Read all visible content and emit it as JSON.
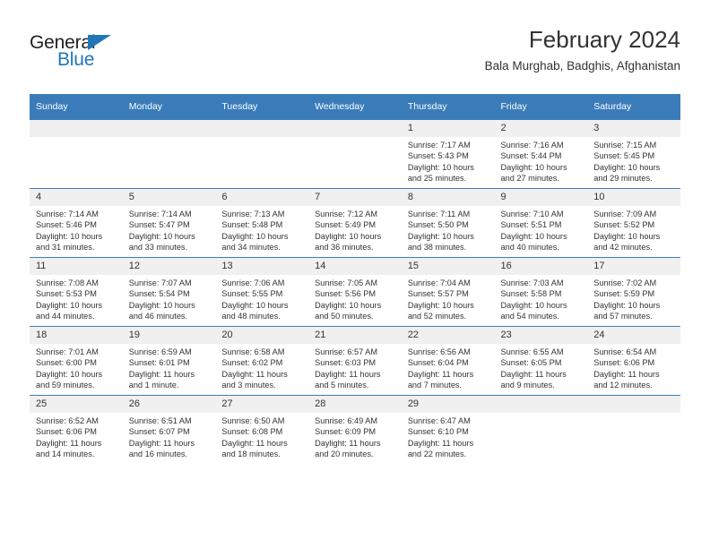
{
  "brand": {
    "name_top": "General",
    "name_bottom": "Blue",
    "accent_color": "#1f77b8"
  },
  "header": {
    "title": "February 2024",
    "subtitle": "Bala Murghab, Badghis, Afghanistan"
  },
  "theme": {
    "header_blue": "#3a7cb9",
    "daynum_gray": "#f0f0f0",
    "text": "#333333"
  },
  "calendar": {
    "weekday_headers": [
      "Sunday",
      "Monday",
      "Tuesday",
      "Wednesday",
      "Thursday",
      "Friday",
      "Saturday"
    ],
    "weeks": [
      [
        {
          "day": "",
          "sunrise": "",
          "sunset": "",
          "daylight_line1": "",
          "daylight_line2": "",
          "empty": true
        },
        {
          "day": "",
          "sunrise": "",
          "sunset": "",
          "daylight_line1": "",
          "daylight_line2": "",
          "empty": true
        },
        {
          "day": "",
          "sunrise": "",
          "sunset": "",
          "daylight_line1": "",
          "daylight_line2": "",
          "empty": true
        },
        {
          "day": "",
          "sunrise": "",
          "sunset": "",
          "daylight_line1": "",
          "daylight_line2": "",
          "empty": true
        },
        {
          "day": "1",
          "sunrise": "Sunrise: 7:17 AM",
          "sunset": "Sunset: 5:43 PM",
          "daylight_line1": "Daylight: 10 hours",
          "daylight_line2": "and 25 minutes.",
          "empty": false
        },
        {
          "day": "2",
          "sunrise": "Sunrise: 7:16 AM",
          "sunset": "Sunset: 5:44 PM",
          "daylight_line1": "Daylight: 10 hours",
          "daylight_line2": "and 27 minutes.",
          "empty": false
        },
        {
          "day": "3",
          "sunrise": "Sunrise: 7:15 AM",
          "sunset": "Sunset: 5:45 PM",
          "daylight_line1": "Daylight: 10 hours",
          "daylight_line2": "and 29 minutes.",
          "empty": false
        }
      ],
      [
        {
          "day": "4",
          "sunrise": "Sunrise: 7:14 AM",
          "sunset": "Sunset: 5:46 PM",
          "daylight_line1": "Daylight: 10 hours",
          "daylight_line2": "and 31 minutes.",
          "empty": false
        },
        {
          "day": "5",
          "sunrise": "Sunrise: 7:14 AM",
          "sunset": "Sunset: 5:47 PM",
          "daylight_line1": "Daylight: 10 hours",
          "daylight_line2": "and 33 minutes.",
          "empty": false
        },
        {
          "day": "6",
          "sunrise": "Sunrise: 7:13 AM",
          "sunset": "Sunset: 5:48 PM",
          "daylight_line1": "Daylight: 10 hours",
          "daylight_line2": "and 34 minutes.",
          "empty": false
        },
        {
          "day": "7",
          "sunrise": "Sunrise: 7:12 AM",
          "sunset": "Sunset: 5:49 PM",
          "daylight_line1": "Daylight: 10 hours",
          "daylight_line2": "and 36 minutes.",
          "empty": false
        },
        {
          "day": "8",
          "sunrise": "Sunrise: 7:11 AM",
          "sunset": "Sunset: 5:50 PM",
          "daylight_line1": "Daylight: 10 hours",
          "daylight_line2": "and 38 minutes.",
          "empty": false
        },
        {
          "day": "9",
          "sunrise": "Sunrise: 7:10 AM",
          "sunset": "Sunset: 5:51 PM",
          "daylight_line1": "Daylight: 10 hours",
          "daylight_line2": "and 40 minutes.",
          "empty": false
        },
        {
          "day": "10",
          "sunrise": "Sunrise: 7:09 AM",
          "sunset": "Sunset: 5:52 PM",
          "daylight_line1": "Daylight: 10 hours",
          "daylight_line2": "and 42 minutes.",
          "empty": false
        }
      ],
      [
        {
          "day": "11",
          "sunrise": "Sunrise: 7:08 AM",
          "sunset": "Sunset: 5:53 PM",
          "daylight_line1": "Daylight: 10 hours",
          "daylight_line2": "and 44 minutes.",
          "empty": false
        },
        {
          "day": "12",
          "sunrise": "Sunrise: 7:07 AM",
          "sunset": "Sunset: 5:54 PM",
          "daylight_line1": "Daylight: 10 hours",
          "daylight_line2": "and 46 minutes.",
          "empty": false
        },
        {
          "day": "13",
          "sunrise": "Sunrise: 7:06 AM",
          "sunset": "Sunset: 5:55 PM",
          "daylight_line1": "Daylight: 10 hours",
          "daylight_line2": "and 48 minutes.",
          "empty": false
        },
        {
          "day": "14",
          "sunrise": "Sunrise: 7:05 AM",
          "sunset": "Sunset: 5:56 PM",
          "daylight_line1": "Daylight: 10 hours",
          "daylight_line2": "and 50 minutes.",
          "empty": false
        },
        {
          "day": "15",
          "sunrise": "Sunrise: 7:04 AM",
          "sunset": "Sunset: 5:57 PM",
          "daylight_line1": "Daylight: 10 hours",
          "daylight_line2": "and 52 minutes.",
          "empty": false
        },
        {
          "day": "16",
          "sunrise": "Sunrise: 7:03 AM",
          "sunset": "Sunset: 5:58 PM",
          "daylight_line1": "Daylight: 10 hours",
          "daylight_line2": "and 54 minutes.",
          "empty": false
        },
        {
          "day": "17",
          "sunrise": "Sunrise: 7:02 AM",
          "sunset": "Sunset: 5:59 PM",
          "daylight_line1": "Daylight: 10 hours",
          "daylight_line2": "and 57 minutes.",
          "empty": false
        }
      ],
      [
        {
          "day": "18",
          "sunrise": "Sunrise: 7:01 AM",
          "sunset": "Sunset: 6:00 PM",
          "daylight_line1": "Daylight: 10 hours",
          "daylight_line2": "and 59 minutes.",
          "empty": false
        },
        {
          "day": "19",
          "sunrise": "Sunrise: 6:59 AM",
          "sunset": "Sunset: 6:01 PM",
          "daylight_line1": "Daylight: 11 hours",
          "daylight_line2": "and 1 minute.",
          "empty": false
        },
        {
          "day": "20",
          "sunrise": "Sunrise: 6:58 AM",
          "sunset": "Sunset: 6:02 PM",
          "daylight_line1": "Daylight: 11 hours",
          "daylight_line2": "and 3 minutes.",
          "empty": false
        },
        {
          "day": "21",
          "sunrise": "Sunrise: 6:57 AM",
          "sunset": "Sunset: 6:03 PM",
          "daylight_line1": "Daylight: 11 hours",
          "daylight_line2": "and 5 minutes.",
          "empty": false
        },
        {
          "day": "22",
          "sunrise": "Sunrise: 6:56 AM",
          "sunset": "Sunset: 6:04 PM",
          "daylight_line1": "Daylight: 11 hours",
          "daylight_line2": "and 7 minutes.",
          "empty": false
        },
        {
          "day": "23",
          "sunrise": "Sunrise: 6:55 AM",
          "sunset": "Sunset: 6:05 PM",
          "daylight_line1": "Daylight: 11 hours",
          "daylight_line2": "and 9 minutes.",
          "empty": false
        },
        {
          "day": "24",
          "sunrise": "Sunrise: 6:54 AM",
          "sunset": "Sunset: 6:06 PM",
          "daylight_line1": "Daylight: 11 hours",
          "daylight_line2": "and 12 minutes.",
          "empty": false
        }
      ],
      [
        {
          "day": "25",
          "sunrise": "Sunrise: 6:52 AM",
          "sunset": "Sunset: 6:06 PM",
          "daylight_line1": "Daylight: 11 hours",
          "daylight_line2": "and 14 minutes.",
          "empty": false
        },
        {
          "day": "26",
          "sunrise": "Sunrise: 6:51 AM",
          "sunset": "Sunset: 6:07 PM",
          "daylight_line1": "Daylight: 11 hours",
          "daylight_line2": "and 16 minutes.",
          "empty": false
        },
        {
          "day": "27",
          "sunrise": "Sunrise: 6:50 AM",
          "sunset": "Sunset: 6:08 PM",
          "daylight_line1": "Daylight: 11 hours",
          "daylight_line2": "and 18 minutes.",
          "empty": false
        },
        {
          "day": "28",
          "sunrise": "Sunrise: 6:49 AM",
          "sunset": "Sunset: 6:09 PM",
          "daylight_line1": "Daylight: 11 hours",
          "daylight_line2": "and 20 minutes.",
          "empty": false
        },
        {
          "day": "29",
          "sunrise": "Sunrise: 6:47 AM",
          "sunset": "Sunset: 6:10 PM",
          "daylight_line1": "Daylight: 11 hours",
          "daylight_line2": "and 22 minutes.",
          "empty": false
        },
        {
          "day": "",
          "sunrise": "",
          "sunset": "",
          "daylight_line1": "",
          "daylight_line2": "",
          "empty": true
        },
        {
          "day": "",
          "sunrise": "",
          "sunset": "",
          "daylight_line1": "",
          "daylight_line2": "",
          "empty": true
        }
      ]
    ]
  }
}
